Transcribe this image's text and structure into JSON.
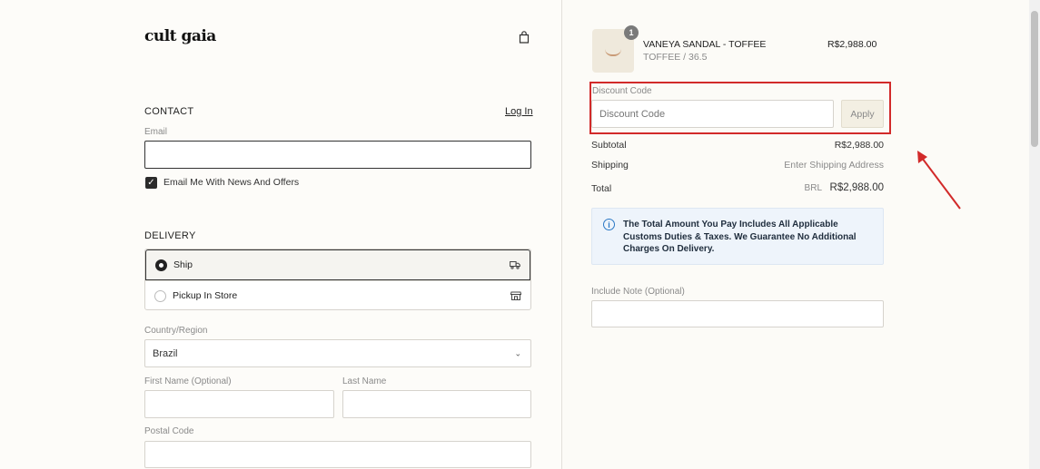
{
  "brand": {
    "logo": "cult gaia"
  },
  "contact": {
    "title": "CONTACT",
    "login": "Log In",
    "email_label": "Email",
    "email_value": "",
    "newsletter_label": "Email Me With News And Offers",
    "newsletter_checked": true
  },
  "delivery": {
    "title": "DELIVERY",
    "options": [
      {
        "label": "Ship",
        "selected": true,
        "icon": "truck-icon"
      },
      {
        "label": "Pickup In Store",
        "selected": false,
        "icon": "store-icon"
      }
    ],
    "country_label": "Country/Region",
    "country_value": "Brazil",
    "first_name_label": "First Name (Optional)",
    "last_name_label": "Last Name",
    "postal_label": "Postal Code"
  },
  "order": {
    "item": {
      "name": "VANEYA SANDAL - TOFFEE",
      "variant": "TOFFEE / 36.5",
      "price": "R$2,988.00",
      "quantity": "1"
    },
    "discount": {
      "label": "Discount Code",
      "placeholder": "Discount Code",
      "apply": "Apply"
    },
    "subtotal_label": "Subtotal",
    "subtotal_value": "R$2,988.00",
    "shipping_label": "Shipping",
    "shipping_value": "Enter Shipping Address",
    "total_label": "Total",
    "total_currency": "BRL",
    "total_value": "R$2,988.00",
    "info": "The Total Amount You Pay Includes All Applicable Customs Duties & Taxes. We Guarantee No Additional Charges On Delivery.",
    "note_label": "Include Note (Optional)"
  },
  "colors": {
    "annotation": "#d22a2a",
    "info_accent": "#2b78c5"
  }
}
